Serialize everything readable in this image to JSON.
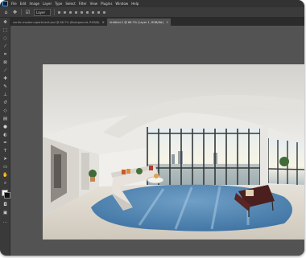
{
  "menubar": {
    "items": [
      "File",
      "Edit",
      "Image",
      "Layer",
      "Type",
      "Select",
      "Filter",
      "View",
      "Plugins",
      "Window",
      "Help"
    ]
  },
  "options_bar": {
    "layer_select": "Layer"
  },
  "tabs": [
    {
      "label": "nordic-modern-apartment.psd @ 66.7% (Background, RGB/8)",
      "close": "×"
    },
    {
      "label": "Untitled-1 @ 66.7% (Layer 1, RGB/8#)",
      "close": "×"
    }
  ],
  "colors": {
    "menubar_bg": "#323232",
    "options_bg": "#3b3b3b",
    "tabs_bg": "#2b2b2b",
    "canvas_bg": "#535353",
    "accent": "#31a8ff",
    "foreground_color": "#ffffff",
    "background_color": "#111111"
  },
  "tools": [
    "move-icon",
    "marquee-icon",
    "lasso-icon",
    "quick-select-icon",
    "crop-icon",
    "frame-icon",
    "eyedropper-icon",
    "spot-heal-icon",
    "brush-icon",
    "clone-stamp-icon",
    "history-brush-icon",
    "eraser-icon",
    "gradient-icon",
    "blur-icon",
    "dodge-icon",
    "pen-icon",
    "type-icon",
    "path-select-icon",
    "rectangle-icon",
    "hand-icon",
    "zoom-icon",
    "more-tools-icon"
  ]
}
